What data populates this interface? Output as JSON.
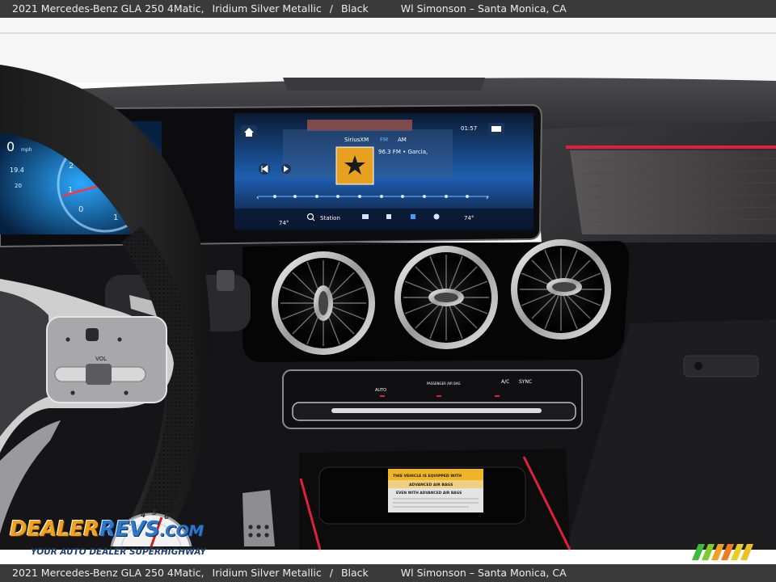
{
  "caption": {
    "model": "2021 Mercedes-Benz GLA 250 4Matic,",
    "color": "Iridium Silver Metallic",
    "separator": "/",
    "interior": "Black",
    "dealer": "Wl Simonson – Santa Monica, CA"
  },
  "screen": {
    "clock": "01:57",
    "source": "SiriusXM",
    "band_fm": "FM",
    "band_am": "AM",
    "station_text": "96.3 FM • Garcia,",
    "station_button": "Station",
    "temp_left": "74°",
    "temp_right": "74°",
    "cluster_speed": "0",
    "cluster_unit": "mph",
    "cluster_odo": "19.4",
    "cluster_small": "20"
  },
  "climate_panel": {
    "passenger_airbag": "PASSENGER AIR BAG",
    "auto": "AUTO",
    "ac": "A/C",
    "sync": "SYNC"
  },
  "steering": {
    "vol_label": "VOL"
  },
  "airbag_label": {
    "line1": "THIS VEHICLE IS EQUIPPED WITH",
    "line2": "ADVANCED AIR BAGS",
    "line3": "EVEN WITH ADVANCED AIR BAGS"
  },
  "watermark": {
    "brand_part1": "DEALER",
    "brand_part2": "REVS",
    "brand_part3": ".COM",
    "tagline": "YOUR AUTO DEALER SUPERHIGHWAY"
  },
  "colors": {
    "ambient_red": "#e0203a",
    "screen_blue": "#2a8cff",
    "caption_bar": "#3a3a3a",
    "brand_orange": "#f0a020",
    "brand_blue": "#2f77c8"
  }
}
